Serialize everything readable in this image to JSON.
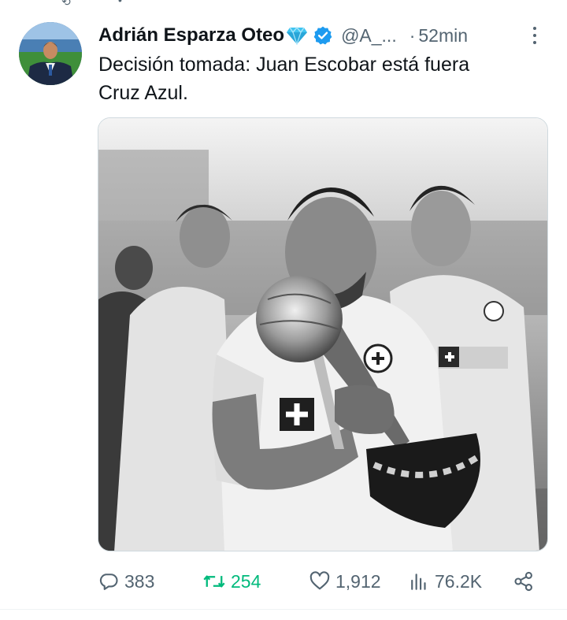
{
  "tweet": {
    "author_name": "Adrián Esparza Oteo",
    "handle": "@A_...",
    "separator": "·",
    "time": "52min",
    "text_lines": [
      "Decisión tomada: Juan Escobar está fuera",
      "Cruz Azul."
    ]
  },
  "icons": {
    "name_badge": "diamond-emoji-icon",
    "verified": "verified-badge-icon",
    "more": "more-vertical-icon",
    "reply": "reply-icon",
    "retweet": "retweet-icon",
    "like": "heart-icon",
    "views": "views-chart-icon",
    "share": "share-icon"
  },
  "actions": {
    "replies": "383",
    "retweets": "254",
    "likes": "1,912",
    "views": "76.2K"
  },
  "colors": {
    "text_primary": "#0f1419",
    "text_secondary": "#536471",
    "retweet_active": "#00ba7c",
    "verified_blue": "#1d9bf0",
    "diamond": "#3fc4f0"
  }
}
